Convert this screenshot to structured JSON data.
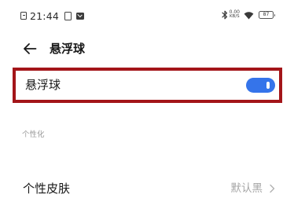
{
  "status_bar": {
    "time": "21:44",
    "net_speed_value": "0.00",
    "net_speed_unit": "KB/S",
    "battery_level": "87",
    "icons": [
      "notification-icon",
      "sim-card-icon",
      "mail-icon",
      "bluetooth-icon",
      "wifi-icon",
      "battery-icon"
    ]
  },
  "header": {
    "back_icon": "arrow-left-icon",
    "title": "悬浮球"
  },
  "settings": {
    "float_ball": {
      "label": "悬浮球",
      "enabled": true,
      "highlighted": true,
      "highlight_color": "#a31519",
      "toggle_color": "#3574ea"
    },
    "section_personalization": "个性化",
    "skin": {
      "label": "个性皮肤",
      "value": "默认黑",
      "chevron_icon": "chevron-right-icon"
    }
  }
}
